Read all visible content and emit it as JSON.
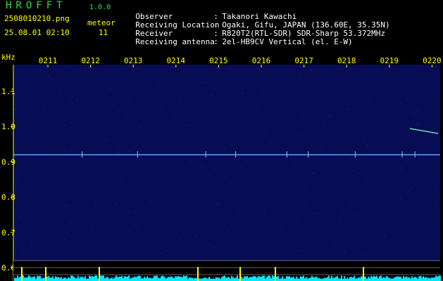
{
  "header": {
    "app_title": "HROFFT",
    "app_version": "1.0.0",
    "filename": "2508010210.png",
    "datetime": "25.08.01 02:10",
    "meteor_label": "meteor",
    "meteor_count": "11",
    "info": [
      {
        "key": "Observer",
        "sep": ":",
        "value": "Takanori Kawachi"
      },
      {
        "key": "Receiving Location",
        "sep": ":",
        "value": "Ogaki, Gifu, JAPAN (136.60E, 35.35N)"
      },
      {
        "key": "Receiver",
        "sep": ":",
        "value": "R820T2(RTL-SDR) SDR-Sharp 53.372MHz"
      },
      {
        "key": "Receiving antenna",
        "sep": ":",
        "value": "2el-HB9CV Vertical (el. E-W)"
      }
    ]
  },
  "colors": {
    "background": "#000000",
    "spectrogram": "#060d55",
    "carrier": "#58a8ff",
    "text_green": "#27e04a",
    "axis_yellow": "#ffff00",
    "level_cyan": "#00e8ff"
  },
  "chart_data": {
    "type": "heatmap",
    "ylabel": "kHz",
    "x_ticks": [
      "0211",
      "0212",
      "0213",
      "0214",
      "0215",
      "0216",
      "0217",
      "0218",
      "0219",
      "0220"
    ],
    "y_ticks": [
      "1.1",
      "1.0",
      "0.9",
      "0.8",
      "0.7",
      "0.6"
    ],
    "x_range_minutes": [
      0,
      10
    ],
    "y_range_khz": [
      0.555,
      1.2
    ],
    "carrier_frequency_khz": 0.92,
    "meteor_echo_minutes": [
      0.8,
      2.1,
      3.7,
      4.4,
      5.6,
      6.1,
      7.2,
      8.3,
      8.6,
      9.4,
      9.9
    ]
  }
}
